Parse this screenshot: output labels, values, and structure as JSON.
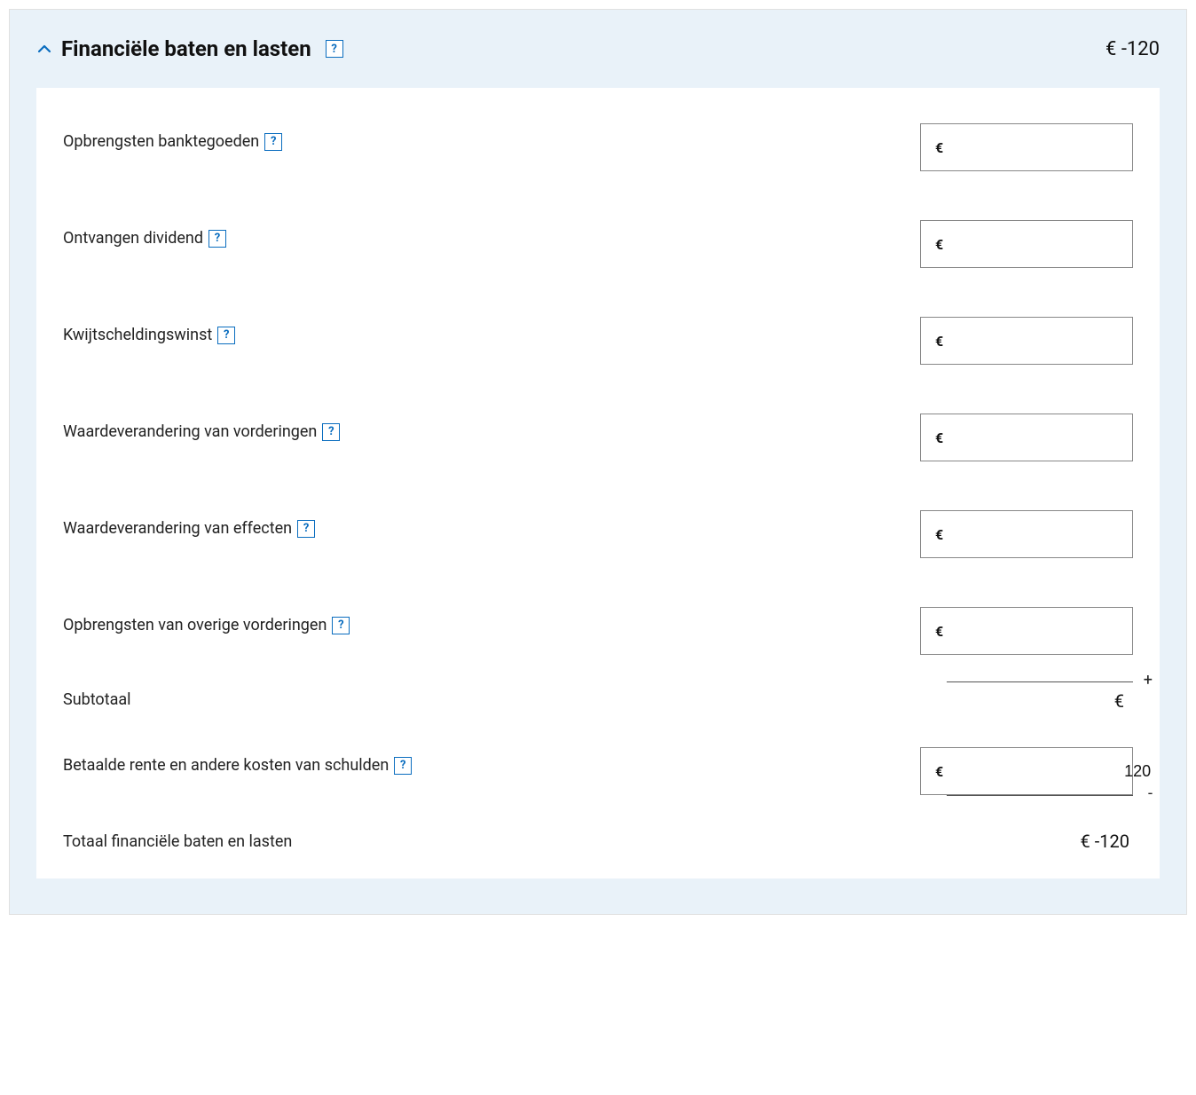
{
  "header": {
    "title": "Financiële baten en lasten",
    "amount": "€ -120",
    "help_glyph": "?"
  },
  "currency_symbol": "€",
  "rows": {
    "r0": {
      "label": "Opbrengsten banktegoeden",
      "value": ""
    },
    "r1": {
      "label": "Ontvangen dividend",
      "value": ""
    },
    "r2": {
      "label": "Kwijtscheldingswinst",
      "value": ""
    },
    "r3": {
      "label": "Waardeverandering van vorderingen",
      "value": ""
    },
    "r4": {
      "label": "Waardeverandering van effecten",
      "value": ""
    },
    "r5": {
      "label": "Opbrengsten van overige vorderingen",
      "value": ""
    },
    "r6": {
      "label": "Betaalde rente en andere kosten van schulden",
      "value": "120"
    }
  },
  "plus_sign": "+",
  "minus_sign": "-",
  "subtotal": {
    "label": "Subtotaal",
    "value": "€"
  },
  "total": {
    "label": "Totaal financiële baten en lasten",
    "value": "€ -120"
  }
}
